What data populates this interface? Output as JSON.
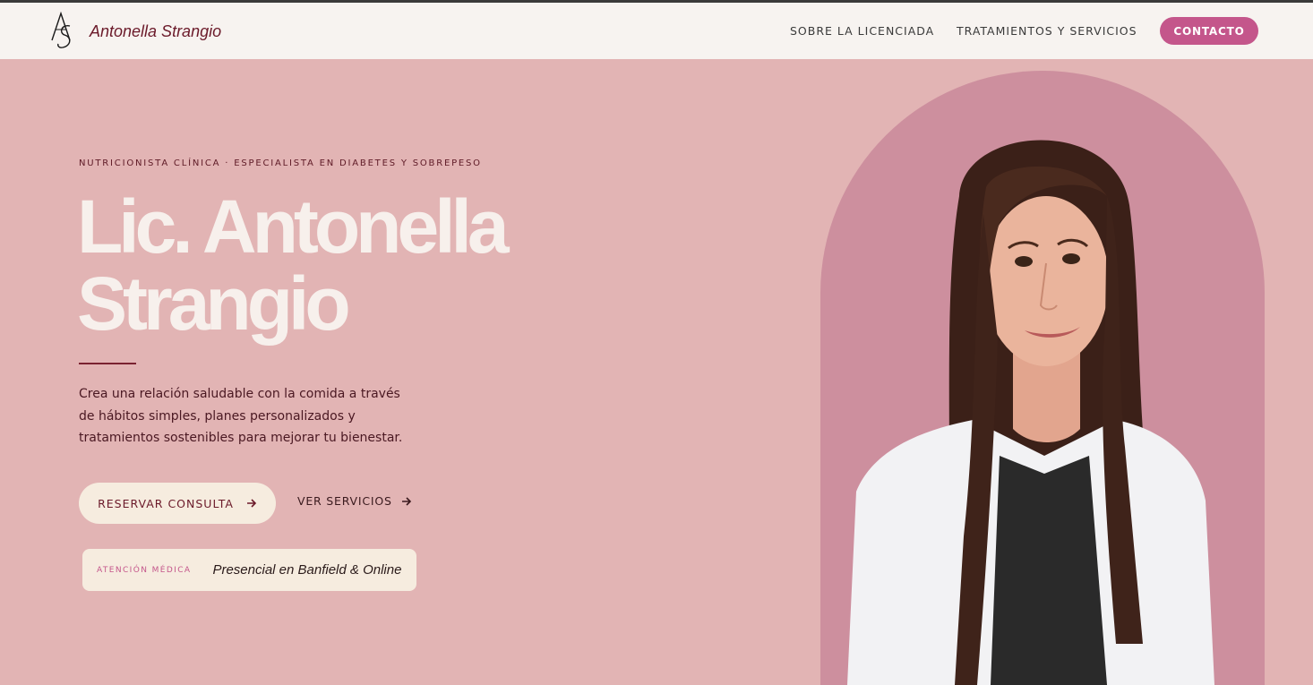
{
  "nav": {
    "brand_name": "Antonella Strangio",
    "logo_icon": "as-monogram-icon",
    "links": [
      "SOBRE LA LICENCIADA",
      "TRATAMIENTOS Y SERVICIOS"
    ],
    "cta": "CONTACTO"
  },
  "hero": {
    "eyebrow": "NUTRICIONISTA CLÍNICA · ESPECIALISTA EN DIABETES Y SOBREPESO",
    "title_line1": "Lic. Antonella",
    "title_line2": "Strangio",
    "lead": "Crea una relación saludable con la comida a través de hábitos simples, planes personalizados y tratamientos sostenibles para mejorar tu bienestar.",
    "primary_button": "RESERVAR CONSULTA",
    "secondary_button": "VER SERVICIOS",
    "arrow_icon": "arrow-right-icon"
  },
  "info_card": {
    "label": "ATENCIÓN MÉDICA",
    "value": "Presencial en Banfield & Online"
  },
  "portrait": {
    "alt": "portrait-photo"
  },
  "colors": {
    "background": "#e2b4b4",
    "navbar": "#f7f3f0",
    "accent": "#c4568b",
    "arch": "#cd8f9e",
    "cream": "#f6ecdf",
    "dark_text": "#6b1a2a"
  }
}
